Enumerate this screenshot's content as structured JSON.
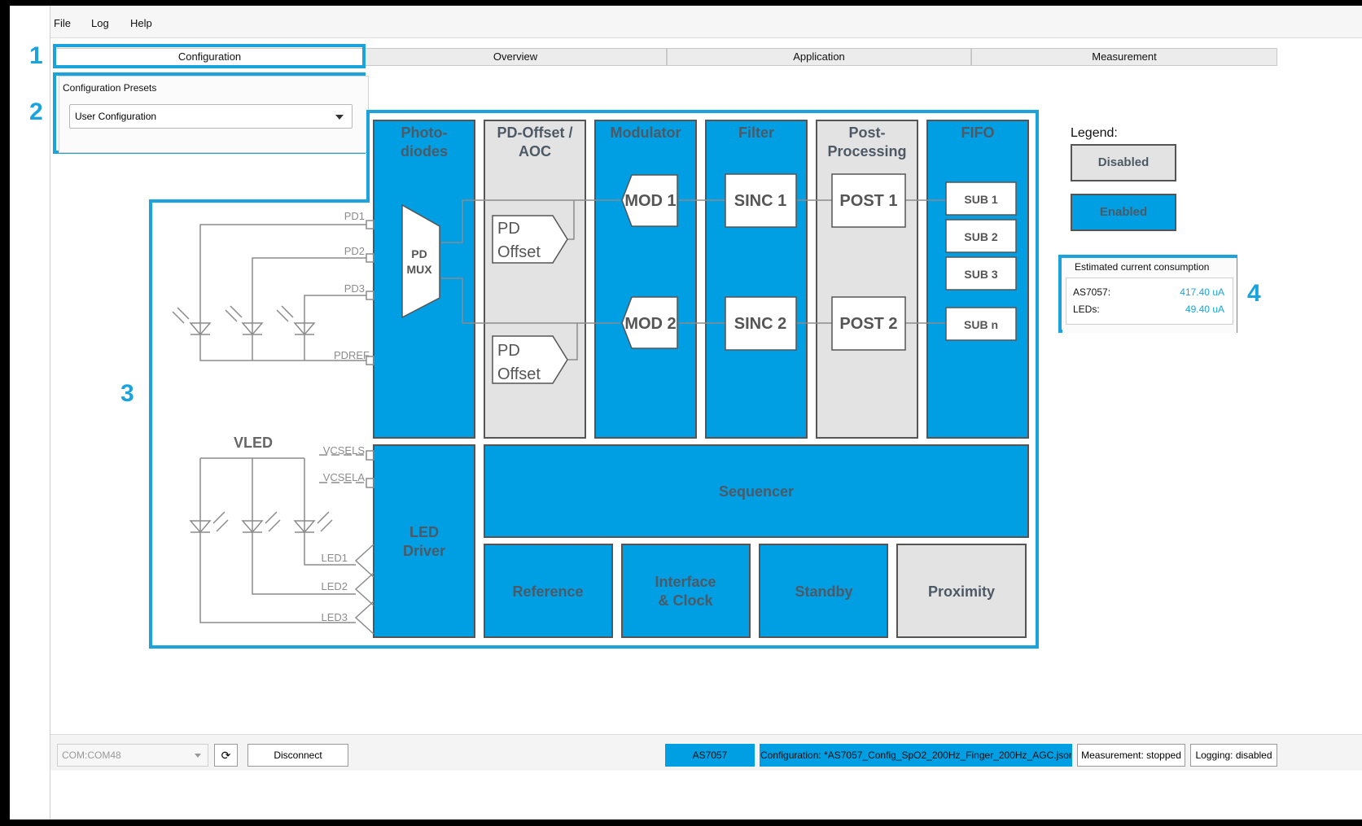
{
  "menu": {
    "file": "File",
    "log": "Log",
    "help": "Help"
  },
  "tabs": [
    {
      "label": "Configuration",
      "active": true
    },
    {
      "label": "Overview"
    },
    {
      "label": "Application"
    },
    {
      "label": "Measurement"
    }
  ],
  "callouts": [
    "1",
    "2",
    "3",
    "4"
  ],
  "presets": {
    "title": "Configuration Presets",
    "selected": "User Configuration"
  },
  "diagram": {
    "pins": {
      "pd1": "PD1",
      "pd2": "PD2",
      "pd3": "PD3",
      "pdref": "PDREF",
      "vcsels": "VCSELS",
      "vcsela": "VCSELA",
      "led1": "LED1",
      "led2": "LED2",
      "led3": "LED3",
      "vled": "VLED"
    },
    "blocks": {
      "photodiodes": [
        "Photo-",
        "diodes"
      ],
      "pd_offset_aoc": [
        "PD-Offset /",
        "AOC"
      ],
      "modulator": "Modulator",
      "filter": "Filter",
      "post_processing": [
        "Post-",
        "Processing"
      ],
      "fifo": "FIFO",
      "pd_mux": [
        "PD",
        "MUX"
      ],
      "pd_offset": [
        "PD",
        "Offset"
      ],
      "mod1": "MOD 1",
      "mod2": "MOD 2",
      "sinc1": "SINC 1",
      "sinc2": "SINC 2",
      "post1": "POST 1",
      "post2": "POST 2",
      "sub1": "SUB 1",
      "sub2": "SUB 2",
      "sub3": "SUB 3",
      "subn": "SUB n",
      "led_driver": [
        "LED",
        "Driver"
      ],
      "sequencer": "Sequencer",
      "reference": "Reference",
      "interface_clock": [
        "Interface",
        "& Clock"
      ],
      "standby": "Standby",
      "proximity": "Proximity"
    }
  },
  "legend": {
    "title": "Legend:",
    "disabled": "Disabled",
    "enabled": "Enabled"
  },
  "consumption": {
    "title": "Estimated current consumption",
    "rows": [
      {
        "label": "AS7057:",
        "value": "417.40 uA"
      },
      {
        "label": "LEDs:",
        "value": "49.40 uA"
      }
    ]
  },
  "statusbar": {
    "com_port": "COM:COM48",
    "disconnect": "Disconnect",
    "device": "AS7057",
    "configuration": "Configuration: *AS7057_Config_SpO2_200Hz_Finger_200Hz_AGC.json",
    "measurement": "Measurement: stopped",
    "logging": "Logging: disabled"
  },
  "colors": {
    "accent": "#1aa3dd",
    "enabled": "#009ee3",
    "disabled": "#e3e3e3",
    "block_text": "#4d5a66"
  }
}
